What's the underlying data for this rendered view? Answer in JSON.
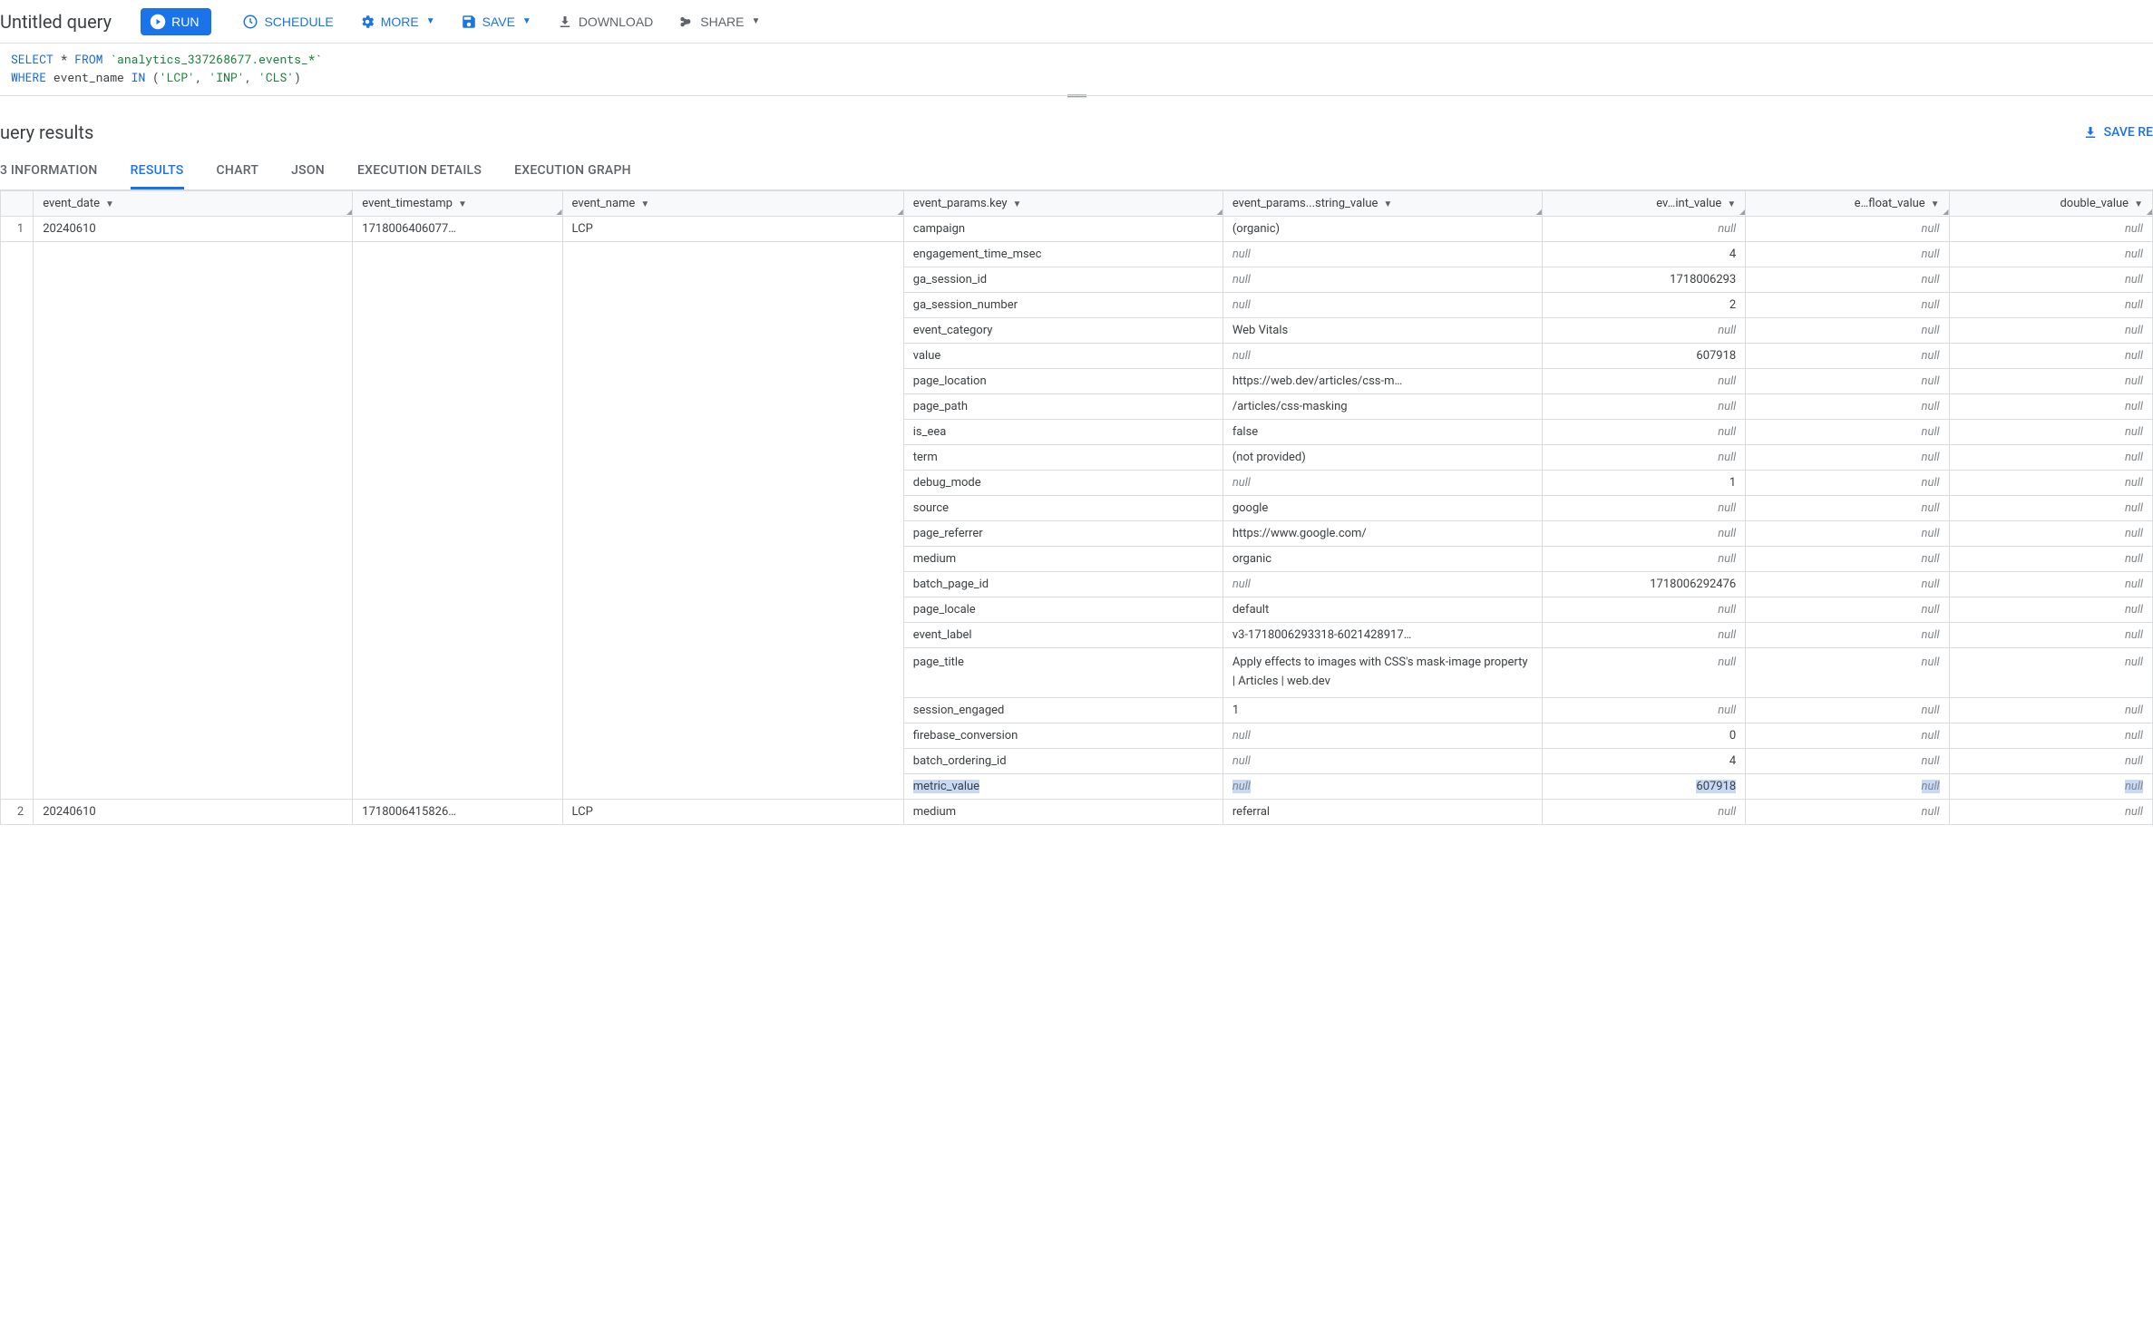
{
  "query_title": "Untitled query",
  "toolbar": {
    "run": "RUN",
    "schedule": "SCHEDULE",
    "more": "MORE",
    "save": "SAVE",
    "download": "DOWNLOAD",
    "share": "SHARE"
  },
  "sql": {
    "kw_select": "SELECT",
    "star": " * ",
    "kw_from": "FROM",
    "table": "`analytics_337268677.events_*`",
    "kw_where": "WHERE",
    "col": " event_name ",
    "kw_in": "IN",
    "paren_open": " (",
    "str1": "'LCP'",
    "comma1": ", ",
    "str2": "'INP'",
    "comma2": ", ",
    "str3": "'CLS'",
    "paren_close": ")"
  },
  "results_title": "uery results",
  "save_results_label": "SAVE RE",
  "tabs": [
    "3 INFORMATION",
    "RESULTS",
    "CHART",
    "JSON",
    "EXECUTION DETAILS",
    "EXECUTION GRAPH"
  ],
  "active_tab": "RESULTS",
  "columns": {
    "row": "",
    "event_date": "event_date",
    "event_timestamp": "event_timestamp",
    "event_name": "event_name",
    "key": "event_params.key",
    "string_value": "event_params...string_value",
    "int_value": "ev…int_value",
    "float_value": "e…float_value",
    "double_value": "double_value"
  },
  "rows": [
    {
      "rownum": "1",
      "event_date": "20240610",
      "event_timestamp": "1718006406077…",
      "event_name": "LCP",
      "params": [
        {
          "key": "campaign",
          "str": "(organic)",
          "int": null,
          "flt": null,
          "dbl": null
        },
        {
          "key": "engagement_time_msec",
          "str": null,
          "int": "4",
          "flt": null,
          "dbl": null
        },
        {
          "key": "ga_session_id",
          "str": null,
          "int": "1718006293",
          "flt": null,
          "dbl": null
        },
        {
          "key": "ga_session_number",
          "str": null,
          "int": "2",
          "flt": null,
          "dbl": null
        },
        {
          "key": "event_category",
          "str": "Web Vitals",
          "int": null,
          "flt": null,
          "dbl": null
        },
        {
          "key": "value",
          "str": null,
          "int": "607918",
          "flt": null,
          "dbl": null
        },
        {
          "key": "page_location",
          "str": "https://web.dev/articles/css-m…",
          "int": null,
          "flt": null,
          "dbl": null
        },
        {
          "key": "page_path",
          "str": "/articles/css-masking",
          "int": null,
          "flt": null,
          "dbl": null
        },
        {
          "key": "is_eea",
          "str": "false",
          "int": null,
          "flt": null,
          "dbl": null
        },
        {
          "key": "term",
          "str": "(not provided)",
          "int": null,
          "flt": null,
          "dbl": null
        },
        {
          "key": "debug_mode",
          "str": null,
          "int": "1",
          "flt": null,
          "dbl": null
        },
        {
          "key": "source",
          "str": "google",
          "int": null,
          "flt": null,
          "dbl": null
        },
        {
          "key": "page_referrer",
          "str": "https://www.google.com/",
          "int": null,
          "flt": null,
          "dbl": null
        },
        {
          "key": "medium",
          "str": "organic",
          "int": null,
          "flt": null,
          "dbl": null
        },
        {
          "key": "batch_page_id",
          "str": null,
          "int": "1718006292476",
          "flt": null,
          "dbl": null
        },
        {
          "key": "page_locale",
          "str": "default",
          "int": null,
          "flt": null,
          "dbl": null
        },
        {
          "key": "event_label",
          "str": "v3-1718006293318-6021428917…",
          "int": null,
          "flt": null,
          "dbl": null
        },
        {
          "key": "page_title",
          "str": "Apply effects to images with CSS's mask-image property  |  Articles  |  web.dev",
          "int": null,
          "flt": null,
          "dbl": null,
          "tall": true
        },
        {
          "key": "session_engaged",
          "str": "1",
          "int": null,
          "flt": null,
          "dbl": null
        },
        {
          "key": "firebase_conversion",
          "str": null,
          "int": "0",
          "flt": null,
          "dbl": null
        },
        {
          "key": "batch_ordering_id",
          "str": null,
          "int": "4",
          "flt": null,
          "dbl": null
        },
        {
          "key": "metric_value",
          "str": null,
          "int": "607918",
          "flt": null,
          "dbl": null,
          "highlight": true
        }
      ]
    },
    {
      "rownum": "2",
      "event_date": "20240610",
      "event_timestamp": "1718006415826…",
      "event_name": "LCP",
      "params": [
        {
          "key": "medium",
          "str": "referral",
          "int": null,
          "flt": null,
          "dbl": null
        }
      ]
    }
  ]
}
